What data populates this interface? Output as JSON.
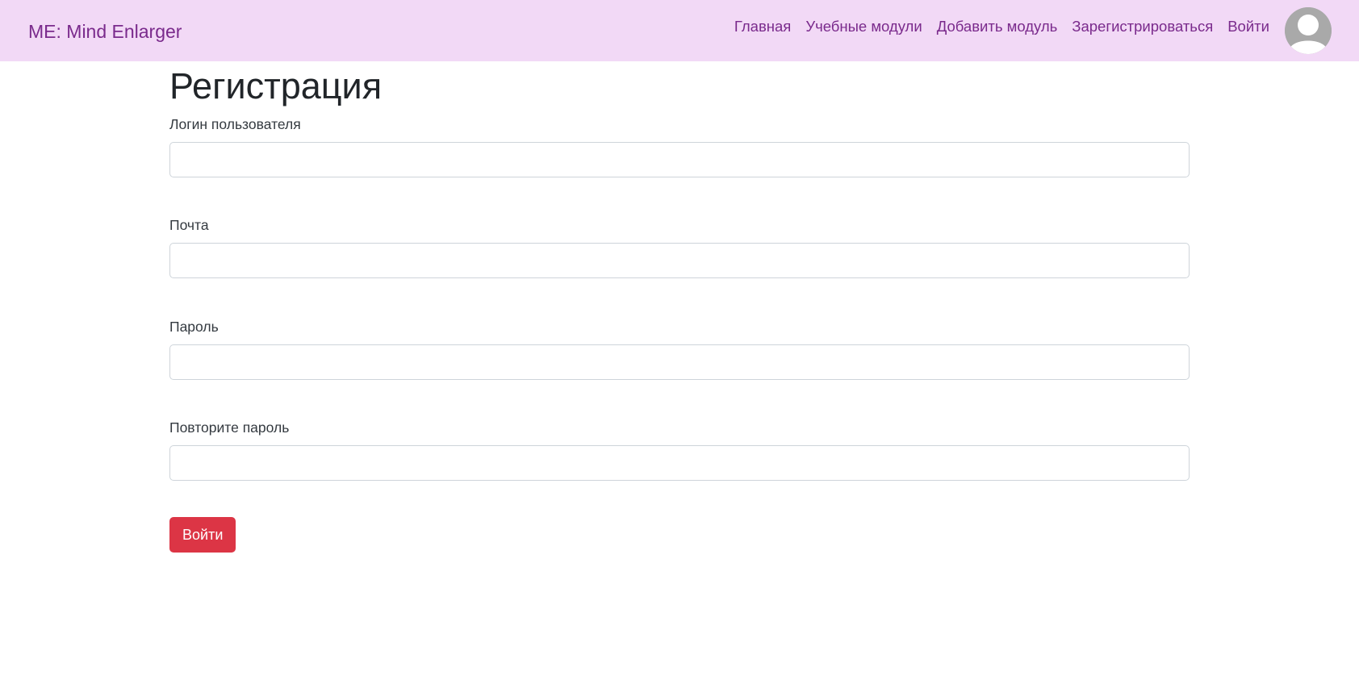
{
  "navbar": {
    "brand": "ME: Mind Enlarger",
    "links": [
      {
        "label": "Главная"
      },
      {
        "label": "Учебные модули"
      },
      {
        "label": "Добавить модуль"
      },
      {
        "label": "Зарегистрироваться"
      },
      {
        "label": "Войти"
      }
    ],
    "avatar_icon": "user-avatar-icon"
  },
  "form": {
    "title": "Регистрация",
    "fields": [
      {
        "label": "Логин пользователя",
        "value": ""
      },
      {
        "label": "Почта",
        "value": ""
      },
      {
        "label": "Пароль",
        "value": ""
      },
      {
        "label": "Повторите пароль",
        "value": ""
      }
    ],
    "submit_label": "Войти"
  },
  "colors": {
    "navbar_bg": "#f2d9f6",
    "nav_text": "#7a2a8c",
    "button_bg": "#dc3545"
  }
}
